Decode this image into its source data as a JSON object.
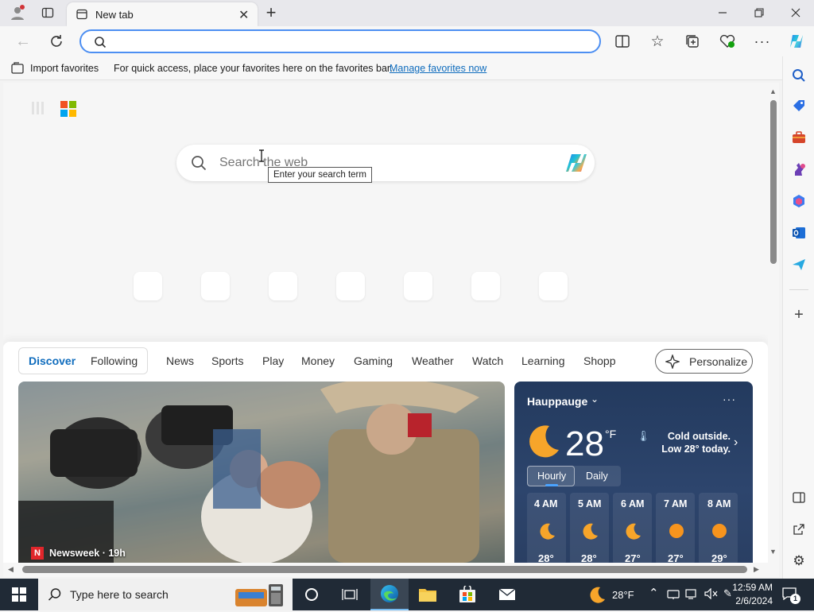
{
  "browser": {
    "tab_title": "New tab",
    "address_value": ""
  },
  "favorites_bar": {
    "import_label": "Import favorites",
    "prompt_text": "For quick access, place your favorites here on the favorites bar.",
    "manage_link": "Manage favorites now"
  },
  "ntp": {
    "search_placeholder": "Search the web",
    "tooltip": "Enter your search term",
    "feed_tabs": [
      "Discover",
      "Following"
    ],
    "nav_items": [
      "News",
      "Sports",
      "Play",
      "Money",
      "Gaming",
      "Weather",
      "Watch",
      "Learning",
      "Shopp"
    ],
    "personalize_label": "Personalize",
    "news_source": "Newsweek · 19h"
  },
  "weather": {
    "location": "Hauppauge",
    "temperature": "28",
    "unit": "°F",
    "summary": "Cold outside. Low 28° today.",
    "tabs": [
      "Hourly",
      "Daily"
    ],
    "hours": [
      {
        "time": "4 AM",
        "temp": "28°",
        "icon": "moon"
      },
      {
        "time": "5 AM",
        "temp": "28°",
        "icon": "moon"
      },
      {
        "time": "6 AM",
        "temp": "27°",
        "icon": "moon"
      },
      {
        "time": "7 AM",
        "temp": "27°",
        "icon": "sun"
      },
      {
        "time": "8 AM",
        "temp": "29°",
        "icon": "sun"
      }
    ]
  },
  "taskbar": {
    "search_placeholder": "Type here to search",
    "weather_temp": "28°F",
    "time": "12:59 AM",
    "date": "2/6/2024",
    "notification_count": "1"
  },
  "colors": {
    "accent": "#0f6cbd",
    "weather_bg": "#2b3f63",
    "taskbar": "#202a36"
  }
}
